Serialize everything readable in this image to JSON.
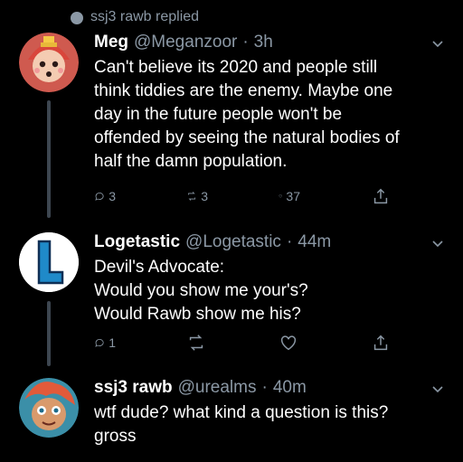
{
  "context": {
    "text": "ssj3 rawb replied",
    "icon": "speech-bubble-icon"
  },
  "tweets": [
    {
      "name": "Meg",
      "handle": "@Meganzoor",
      "dot": "·",
      "time": "3h",
      "text": "Can't believe its 2020 and people still\nthink tiddies are the enemy. Maybe one\nday in the future people won't be\noffended by seeing the natural bodies of\nhalf the damn population.",
      "replies": "3",
      "retweets": "3",
      "likes": "37"
    },
    {
      "name": "Logetastic",
      "handle": "@Logetastic",
      "dot": "·",
      "time": "44m",
      "text": "Devil's Advocate:\nWould you show me your's?\nWould Rawb show me his?",
      "replies": "1",
      "retweets": "",
      "likes": ""
    },
    {
      "name": "ssj3 rawb",
      "handle": "@urealms",
      "dot": "·",
      "time": "40m",
      "text": "wtf dude? what kind a question is this?\ngross",
      "replies": "",
      "retweets": "",
      "likes": ""
    }
  ],
  "colors": {
    "background": "#000000",
    "text": "#ffffff",
    "muted": "#8b98a5",
    "thread": "#3d4650"
  }
}
